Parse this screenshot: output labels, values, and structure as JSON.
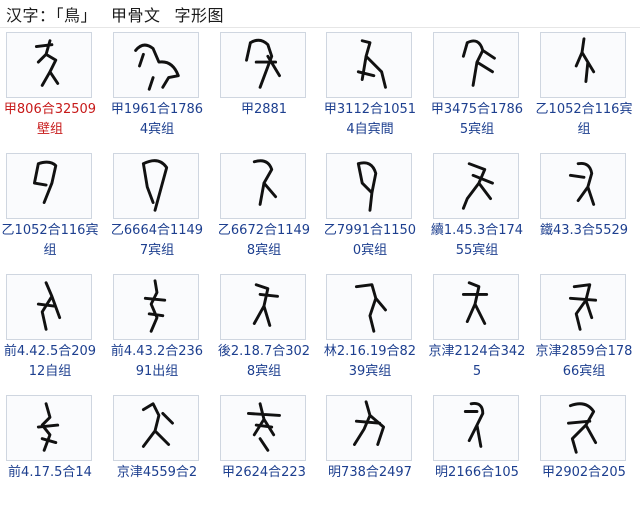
{
  "header": {
    "title": "汉字：「鳥」",
    "part1": "甲骨文",
    "part2": "字形图"
  },
  "items": [
    {
      "caption": "甲806合32509壁组",
      "selected": true
    },
    {
      "caption": "甲1961合17864宾组",
      "selected": false
    },
    {
      "caption": "甲2881",
      "selected": false
    },
    {
      "caption": "甲3112合10514自宾間",
      "selected": false
    },
    {
      "caption": "甲3475合17865宾组",
      "selected": false
    },
    {
      "caption": "乙1052合116宾组",
      "selected": false
    },
    {
      "caption": "乙1052合116宾组",
      "selected": false
    },
    {
      "caption": "乙6664合11497宾组",
      "selected": false
    },
    {
      "caption": "乙6672合11498宾组",
      "selected": false
    },
    {
      "caption": "乙7991合11500宾组",
      "selected": false
    },
    {
      "caption": "續1.45.3合17455宾组",
      "selected": false
    },
    {
      "caption": "鐵43.3合5529",
      "selected": false
    },
    {
      "caption": "前4.42.5合20912自组",
      "selected": false
    },
    {
      "caption": "前4.43.2合23691出组",
      "selected": false
    },
    {
      "caption": "後2.18.7合3028宾组",
      "selected": false
    },
    {
      "caption": "林2.16.19合8239宾组",
      "selected": false
    },
    {
      "caption": "京津2124合3425",
      "selected": false
    },
    {
      "caption": "京津2859合17866宾组",
      "selected": false
    },
    {
      "caption": "前4.17.5合14",
      "selected": false
    },
    {
      "caption": "京津4559合2",
      "selected": false
    },
    {
      "caption": "甲2624合223",
      "selected": false
    },
    {
      "caption": "明738合2497",
      "selected": false
    },
    {
      "caption": "明2166合105",
      "selected": false
    },
    {
      "caption": "甲2902合205",
      "selected": false
    }
  ]
}
